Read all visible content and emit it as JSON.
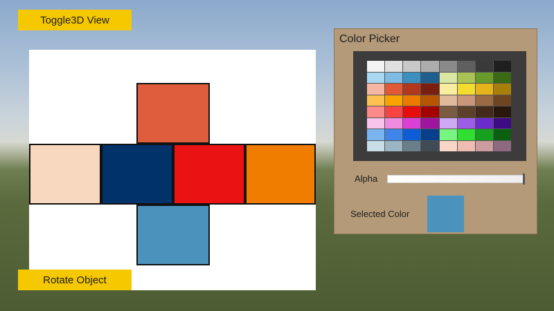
{
  "buttons": {
    "toggle_view": "Toggle3D View",
    "rotate_object": "Rotate Object"
  },
  "cube_faces": {
    "top": "#df5c3c",
    "left": "#f9d8c0",
    "front": "#02326a",
    "right": "#ea1212",
    "back": "#f07d00",
    "bottom": "#4b92bd"
  },
  "color_picker": {
    "title": "Color Picker",
    "alpha_label": "Alpha",
    "alpha_value": 1.0,
    "selected_label": "Selected Color",
    "selected_color": "#4b92bd",
    "swatches": [
      [
        "#f3f3f3",
        "#e0e0e0",
        "#c8c8c8",
        "#adadad",
        "#8a8a8a",
        "#5f5f5f",
        "#3a3a3a",
        "#1f1f1f"
      ],
      [
        "#a9d8f2",
        "#7fbce3",
        "#3d8fc0",
        "#1f5f8d",
        "#d9e7a3",
        "#a9c455",
        "#689b2a",
        "#3a6a14"
      ],
      [
        "#f7b5a3",
        "#e05a37",
        "#b1381c",
        "#7a1f0f",
        "#f9eda0",
        "#f2dc2f",
        "#e5b41a",
        "#a97f0b"
      ],
      [
        "#fcc150",
        "#f7a300",
        "#ec7a00",
        "#b85500",
        "#e0b89b",
        "#c9967a",
        "#9a6a42",
        "#6d4520"
      ],
      [
        "#fc8a88",
        "#f64343",
        "#e80c0c",
        "#a40000",
        "#7c5b43",
        "#5e3f29",
        "#43291a",
        "#2a170c"
      ],
      [
        "#f8c4ec",
        "#ef8ce0",
        "#dc3fd6",
        "#9f159f",
        "#cfa9f3",
        "#9e5de5",
        "#6b2ccc",
        "#3d0c85"
      ],
      [
        "#7ab5f0",
        "#3f86ea",
        "#0d5ed6",
        "#083f8c",
        "#78f57f",
        "#2fe033",
        "#15a11d",
        "#0b5f10"
      ],
      [
        "#c8dde8",
        "#9cb5c4",
        "#6b7f8a",
        "#3f4c55",
        "#fad6c8",
        "#efbcb1",
        "#cc9c9f",
        "#8e6a7e"
      ]
    ]
  }
}
